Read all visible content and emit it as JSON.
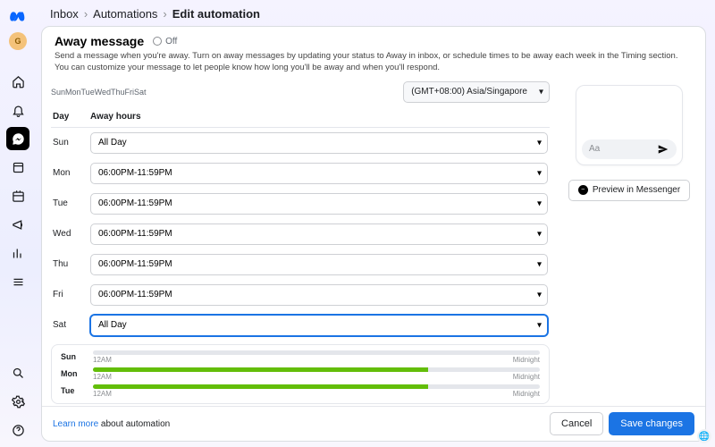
{
  "breadcrumbs": {
    "a": "Inbox",
    "b": "Automations",
    "c": "Edit automation"
  },
  "header": {
    "title": "Away message",
    "toggle": "Off",
    "desc": "Send a message when you're away. Turn on away messages by updating your status to Away in inbox, or schedule times to be away each week in the Timing section. You can customize your message to let people know how long you'll be away and when you'll respond."
  },
  "timezone": {
    "label": "(GMT+08:00) Asia/Singapore"
  },
  "daystrip": "SunMonTueWedThuFriSat",
  "columns": {
    "day": "Day",
    "hours": "Away hours"
  },
  "rows": [
    {
      "day": "Sun",
      "value": "All Day",
      "active": false
    },
    {
      "day": "Mon",
      "value": "06:00PM-11:59PM",
      "active": false
    },
    {
      "day": "Tue",
      "value": "06:00PM-11:59PM",
      "active": false
    },
    {
      "day": "Wed",
      "value": "06:00PM-11:59PM",
      "active": false
    },
    {
      "day": "Thu",
      "value": "06:00PM-11:59PM",
      "active": false
    },
    {
      "day": "Fri",
      "value": "06:00PM-11:59PM",
      "active": false
    },
    {
      "day": "Sat",
      "value": "All Day",
      "active": true
    }
  ],
  "timeline": {
    "start": "12AM",
    "end": "Midnight",
    "rows": [
      {
        "day": "Sun",
        "fill_left": 0,
        "fill_width": 0
      },
      {
        "day": "Mon",
        "fill_left": 0,
        "fill_width": 75
      },
      {
        "day": "Tue",
        "fill_left": 0,
        "fill_width": 75
      }
    ]
  },
  "preview": {
    "placeholder": "Aa",
    "button": "Preview in Messenger"
  },
  "footer": {
    "learn_link": "Learn more",
    "learn_rest": " about automation",
    "cancel": "Cancel",
    "save": "Save changes"
  },
  "avatar_initial": "G"
}
